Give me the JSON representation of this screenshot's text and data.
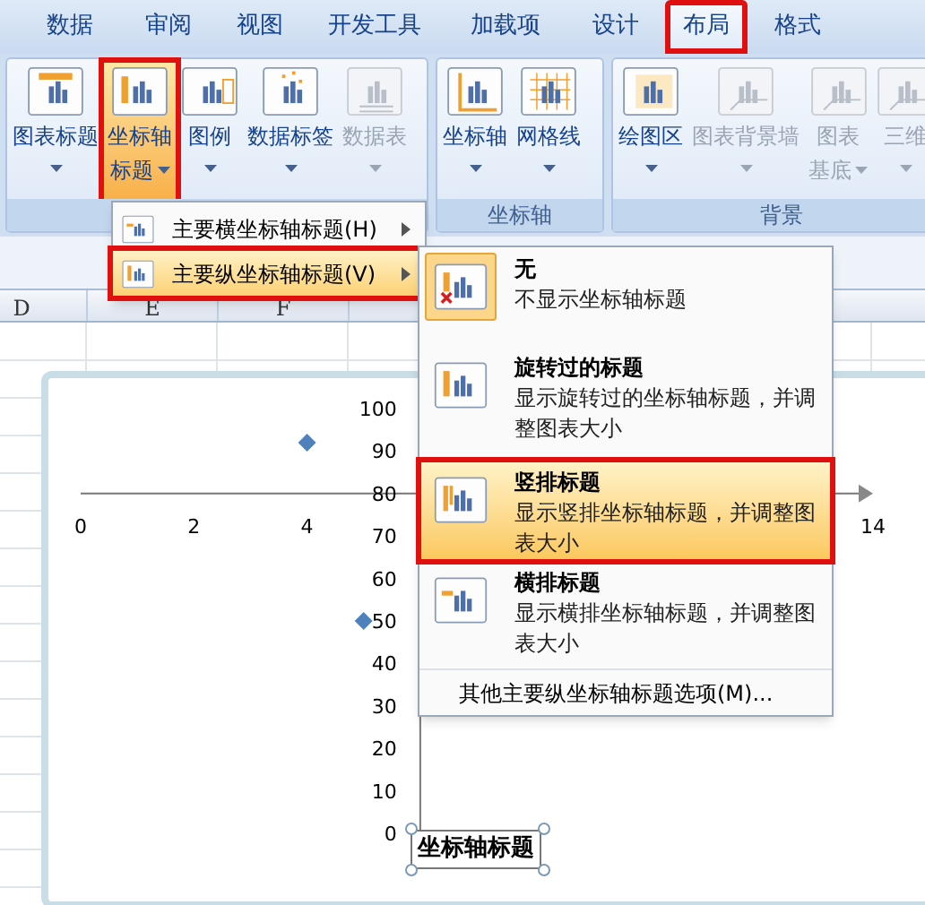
{
  "ribbon_tabs": [
    {
      "label": "数据",
      "selected": false,
      "annotated": false
    },
    {
      "label": "审阅",
      "selected": false,
      "annotated": false
    },
    {
      "label": "视图",
      "selected": false,
      "annotated": false
    },
    {
      "label": "开发工具",
      "selected": false,
      "annotated": false
    },
    {
      "label": "加载项",
      "selected": false,
      "annotated": false
    },
    {
      "label": "设计",
      "selected": false,
      "annotated": false
    },
    {
      "label": "布局",
      "selected": true,
      "annotated": true
    },
    {
      "label": "格式",
      "selected": false,
      "annotated": false
    }
  ],
  "ribbon_groups": [
    {
      "buttons": [
        {
          "kind": "title",
          "lines": [
            "图表标题"
          ],
          "disabled": false,
          "pressed": false,
          "annotated": false
        },
        {
          "kind": "axis_title",
          "lines": [
            "坐标轴",
            "标题"
          ],
          "disabled": false,
          "pressed": true,
          "annotated": true
        },
        {
          "kind": "legend",
          "lines": [
            "图例"
          ],
          "disabled": false,
          "pressed": false,
          "annotated": false
        },
        {
          "kind": "labels",
          "lines": [
            "数据标签"
          ],
          "disabled": false,
          "pressed": false,
          "annotated": false
        },
        {
          "kind": "table",
          "lines": [
            "数据表"
          ],
          "disabled": true,
          "pressed": false,
          "annotated": false
        }
      ]
    },
    {
      "label": "坐标轴",
      "buttons": [
        {
          "kind": "axes",
          "lines": [
            "坐标轴"
          ],
          "disabled": false,
          "pressed": false,
          "annotated": false
        },
        {
          "kind": "grid",
          "lines": [
            "网格线"
          ],
          "disabled": false,
          "pressed": false,
          "annotated": false
        }
      ]
    },
    {
      "label": "背景",
      "buttons": [
        {
          "kind": "plot",
          "lines": [
            "绘图区"
          ],
          "disabled": false,
          "pressed": false,
          "annotated": false
        },
        {
          "kind": "wall",
          "lines": [
            "图表背景墙"
          ],
          "disabled": true,
          "pressed": false,
          "annotated": false
        },
        {
          "kind": "floor",
          "lines": [
            "图表",
            "基底"
          ],
          "disabled": true,
          "pressed": false,
          "annotated": false
        },
        {
          "kind": "solid",
          "lines": [
            "三维"
          ],
          "disabled": true,
          "pressed": false,
          "annotated": false
        }
      ]
    }
  ],
  "column_headers": [
    "D",
    "E",
    "F"
  ],
  "chart": {
    "chart_data": {
      "type": "scatter",
      "x": [
        4,
        5
      ],
      "series": [
        {
          "color": "#4f81bd",
          "values": [
            92,
            50
          ]
        }
      ],
      "xticks": [
        0,
        2,
        4,
        14
      ],
      "xlim": [
        0,
        14
      ],
      "ylim": [
        0,
        100
      ],
      "yticks": [
        0,
        10,
        20,
        30,
        40,
        50,
        60,
        70,
        80,
        90,
        100
      ]
    },
    "axis_title": "坐标轴标题"
  },
  "axis_title_menu": {
    "items": [
      {
        "label": "主要横坐标轴标题(H)",
        "highlighted": false,
        "annotated": false
      },
      {
        "label": "主要纵坐标轴标题(V)",
        "highlighted": true,
        "annotated": true
      }
    ]
  },
  "vertical_axis_submenu": {
    "items": [
      {
        "kind": "none",
        "title": "无",
        "description": "不显示坐标轴标题",
        "checked": true,
        "highlighted": false,
        "annotated": false
      },
      {
        "kind": "rotated",
        "title": "旋转过的标题",
        "description": "显示旋转过的坐标轴标题，并调整图表大小",
        "checked": false,
        "highlighted": false,
        "annotated": false
      },
      {
        "kind": "vertical",
        "title": "竖排标题",
        "description": "显示竖排坐标轴标题，并调整图表大小",
        "checked": false,
        "highlighted": true,
        "annotated": true
      },
      {
        "kind": "horizontal",
        "title": "横排标题",
        "description": "显示横排坐标轴标题，并调整图表大小",
        "checked": false,
        "highlighted": false,
        "annotated": false
      }
    ],
    "footer": "其他主要纵坐标轴标题选项(M)..."
  }
}
